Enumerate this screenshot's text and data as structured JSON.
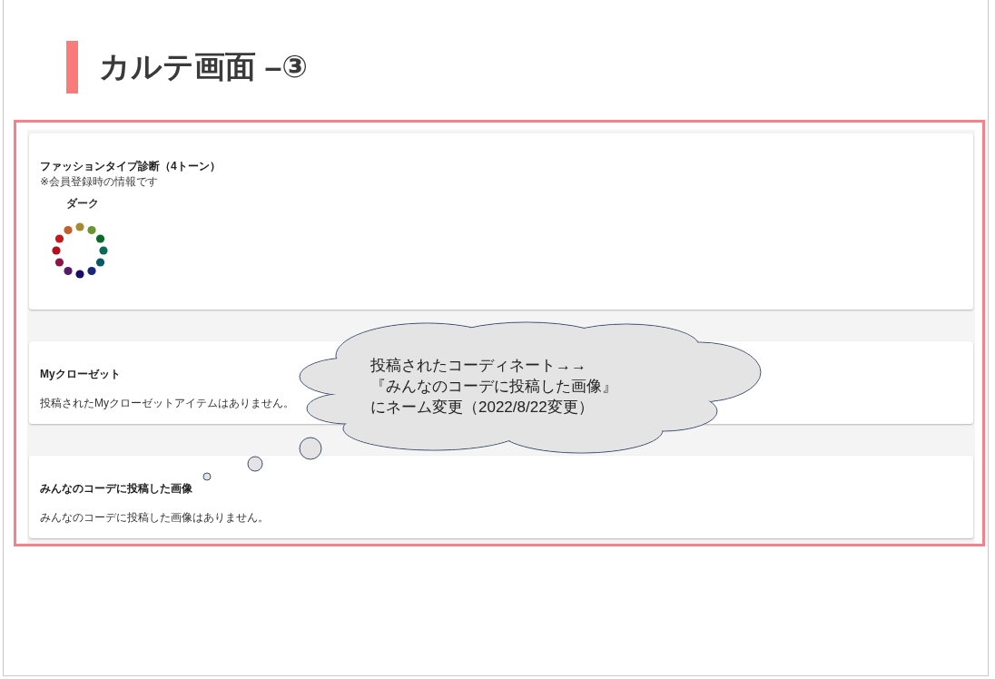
{
  "slide": {
    "title": "カルテ画面 –③"
  },
  "cards": [
    {
      "kind": "diagnosis",
      "title": "ファッションタイプ診断（4トーン）",
      "note": "※会員登録時の情報です",
      "tone": "ダーク",
      "palette": [
        {
          "color": "#a58c30"
        },
        {
          "color": "#6a9530"
        },
        {
          "color": "#0b6a2a"
        },
        {
          "color": "#0b6a58"
        },
        {
          "color": "#0b5866"
        },
        {
          "color": "#15287a"
        },
        {
          "color": "#1c0c6a"
        },
        {
          "color": "#581a6a"
        },
        {
          "color": "#8a1748"
        },
        {
          "color": "#b3101e"
        },
        {
          "color": "#c21a1a"
        },
        {
          "color": "#c0602a"
        }
      ]
    },
    {
      "kind": "message",
      "title": "Myクローゼット",
      "message": "投稿されたMyクローゼットアイテムはありません。"
    },
    {
      "kind": "message",
      "title": "みんなのコーデに投稿した画像",
      "message": "みんなのコーデに投稿した画像はありません。"
    }
  ],
  "callout": {
    "lines": [
      "投稿されたコーディネート→→",
      "『みんなのコーデに投稿した画像』",
      "にネーム変更（2022/8/22変更）"
    ]
  }
}
